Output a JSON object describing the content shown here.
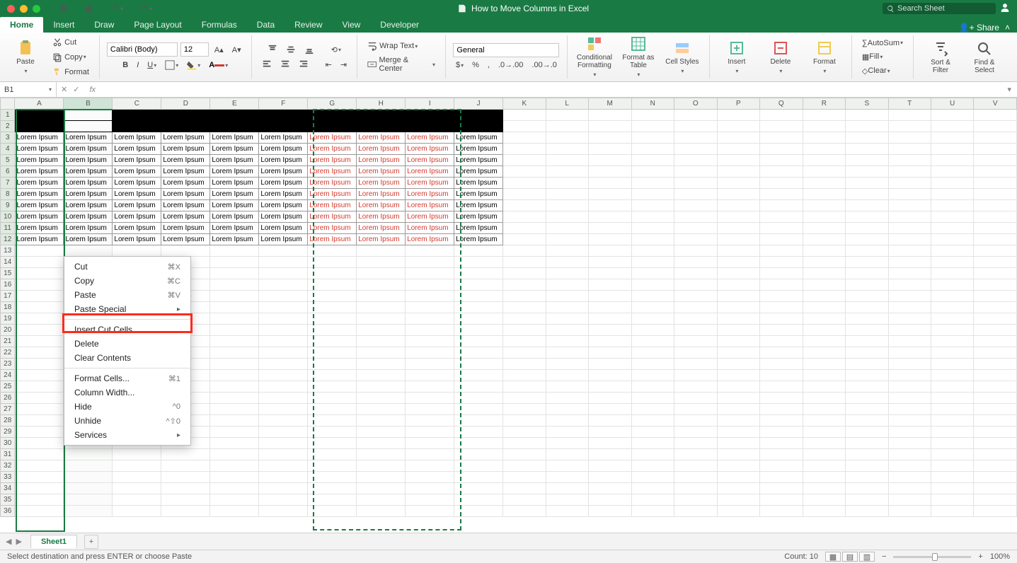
{
  "title": "How to Move Columns in Excel",
  "search_placeholder": "Search Sheet",
  "tabs": [
    "Home",
    "Insert",
    "Draw",
    "Page Layout",
    "Formulas",
    "Data",
    "Review",
    "View",
    "Developer"
  ],
  "share": "Share",
  "ribbon": {
    "paste": "Paste",
    "cut": "Cut",
    "copy": "Copy",
    "format": "Format",
    "font_name": "Calibri (Body)",
    "font_size": "12",
    "wrap": "Wrap Text",
    "merge": "Merge & Center",
    "num_format": "General",
    "cond": "Conditional\nFormatting",
    "fat": "Format\nas Table",
    "cstyles": "Cell\nStyles",
    "insert": "Insert",
    "delete": "Delete",
    "formatc": "Format",
    "autosum": "AutoSum",
    "fill": "Fill",
    "clear": "Clear",
    "sort": "Sort &\nFilter",
    "find": "Find &\nSelect"
  },
  "namebox": "B1",
  "columns": [
    "A",
    "B",
    "C",
    "D",
    "E",
    "F",
    "G",
    "H",
    "I",
    "J",
    "K",
    "L",
    "M",
    "N",
    "O",
    "P",
    "Q",
    "R",
    "S",
    "T",
    "U",
    "V"
  ],
  "row_count": 36,
  "data_rows": 10,
  "data_cols": 10,
  "red_cols": [
    6,
    7,
    8
  ],
  "cut_cols": [
    6,
    7,
    8
  ],
  "cell_text": "Lorem Ipsum",
  "context_menu": [
    {
      "label": "Cut",
      "shortcut": "⌘X"
    },
    {
      "label": "Copy",
      "shortcut": "⌘C"
    },
    {
      "label": "Paste",
      "shortcut": "⌘V"
    },
    {
      "label": "Paste Special",
      "submenu": true
    },
    {
      "sep": true
    },
    {
      "label": "Insert Cut Cells",
      "highlight": true
    },
    {
      "label": "Delete"
    },
    {
      "label": "Clear Contents"
    },
    {
      "sep": true
    },
    {
      "label": "Format Cells...",
      "shortcut": "⌘1"
    },
    {
      "label": "Column Width..."
    },
    {
      "label": "Hide",
      "shortcut": "^0"
    },
    {
      "label": "Unhide",
      "shortcut": "^⇧0"
    },
    {
      "label": "Services",
      "submenu": true
    }
  ],
  "sheet_tab": "Sheet1",
  "status_msg": "Select destination and press ENTER or choose Paste",
  "status_count": "Count: 10",
  "zoom": "100%"
}
